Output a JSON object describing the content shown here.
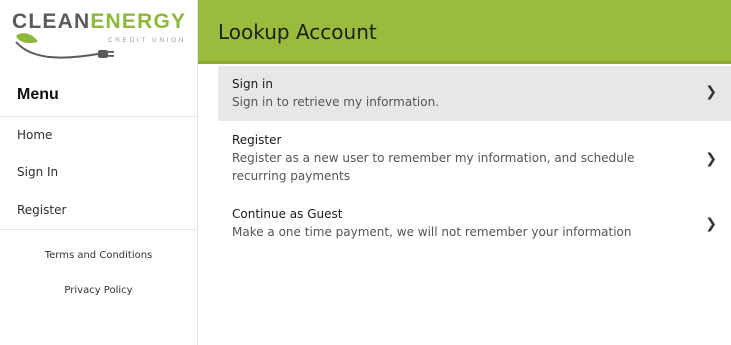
{
  "logo": {
    "brand_part1": "CLEAN",
    "brand_part2": "ENERGY",
    "tagline": "CREDIT UNION",
    "green": "#8db83b",
    "gray": "#5a5a5a",
    "icon": "plug-icon"
  },
  "header": {
    "title": "Lookup Account",
    "bg_color": "#9bbb3d"
  },
  "sidebar": {
    "menu_title": "Menu",
    "nav": [
      {
        "label": "Home"
      },
      {
        "label": "Sign In"
      },
      {
        "label": "Register"
      }
    ],
    "footer_links": [
      {
        "label": "Terms and Conditions"
      },
      {
        "label": "Privacy Policy"
      }
    ]
  },
  "options": [
    {
      "label": "Sign in",
      "description": "Sign in to retrieve my information.",
      "icon": "chevron-right-icon"
    },
    {
      "label": "Register",
      "description": "Register as a new user to remember my information, and schedule recurring payments",
      "icon": "chevron-right-icon"
    },
    {
      "label": "Continue as Guest",
      "description": "Make a one time payment, we will not remember your information",
      "icon": "chevron-right-icon"
    }
  ]
}
